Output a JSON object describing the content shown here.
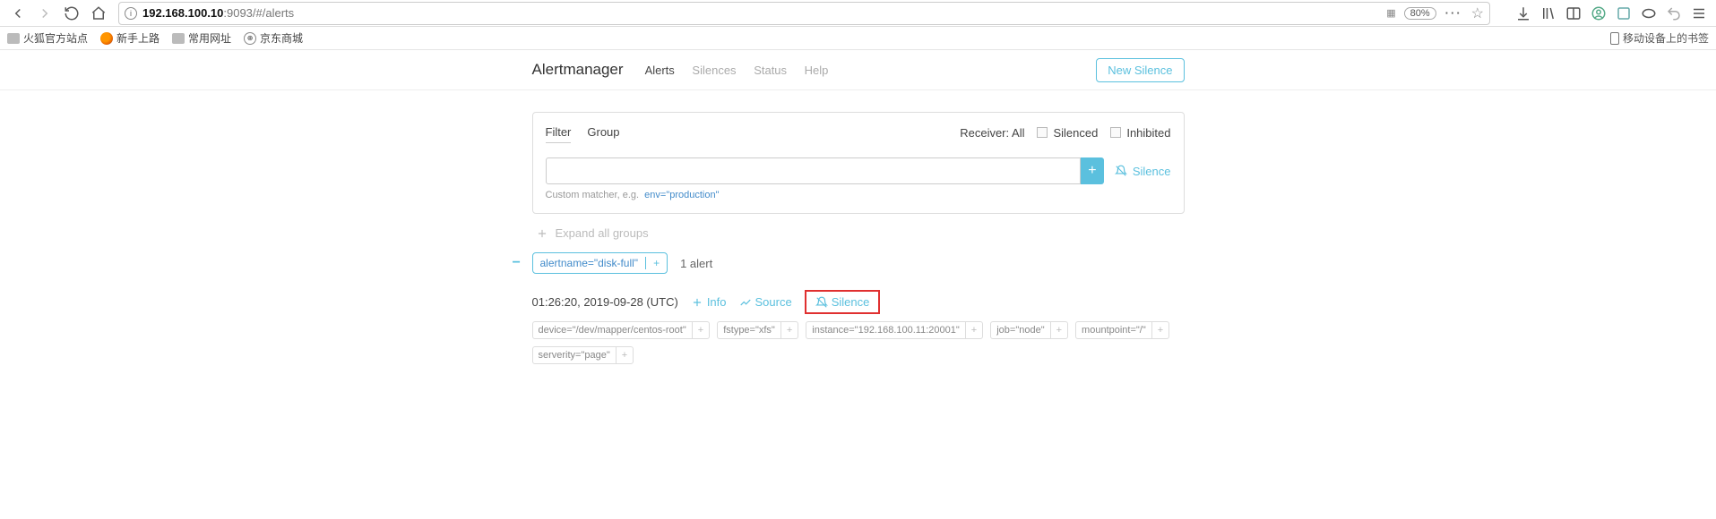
{
  "browser": {
    "url_host": "192.168.100.10",
    "url_path": ":9093/#/alerts",
    "zoom": "80%",
    "qr_label": "QR"
  },
  "bookmarks": {
    "items": [
      "火狐官方站点",
      "新手上路",
      "常用网址",
      "京东商城"
    ],
    "mobile": "移动设备上的书签"
  },
  "header": {
    "brand": "Alertmanager",
    "nav": {
      "alerts": "Alerts",
      "silences": "Silences",
      "status": "Status",
      "help": "Help"
    },
    "new_silence": "New Silence"
  },
  "filter_panel": {
    "tab_filter": "Filter",
    "tab_group": "Group",
    "receiver_label": "Receiver: All",
    "silenced": "Silenced",
    "inhibited": "Inhibited",
    "add_label": "+",
    "silence_link": "Silence",
    "hint_prefix": "Custom matcher, e.g.",
    "hint_example": "env=\"production\""
  },
  "expand_all": "Expand all groups",
  "group": {
    "matcher": "alertname=\"disk-full\"",
    "matcher_plus": "+",
    "count": "1 alert"
  },
  "alert": {
    "timestamp": "01:26:20, 2019-09-28 (UTC)",
    "info": "Info",
    "source": "Source",
    "silence": "Silence",
    "labels": [
      "device=\"/dev/mapper/centos-root\"",
      "fstype=\"xfs\"",
      "instance=\"192.168.100.11:20001\"",
      "job=\"node\"",
      "mountpoint=\"/\"",
      "serverity=\"page\""
    ]
  }
}
